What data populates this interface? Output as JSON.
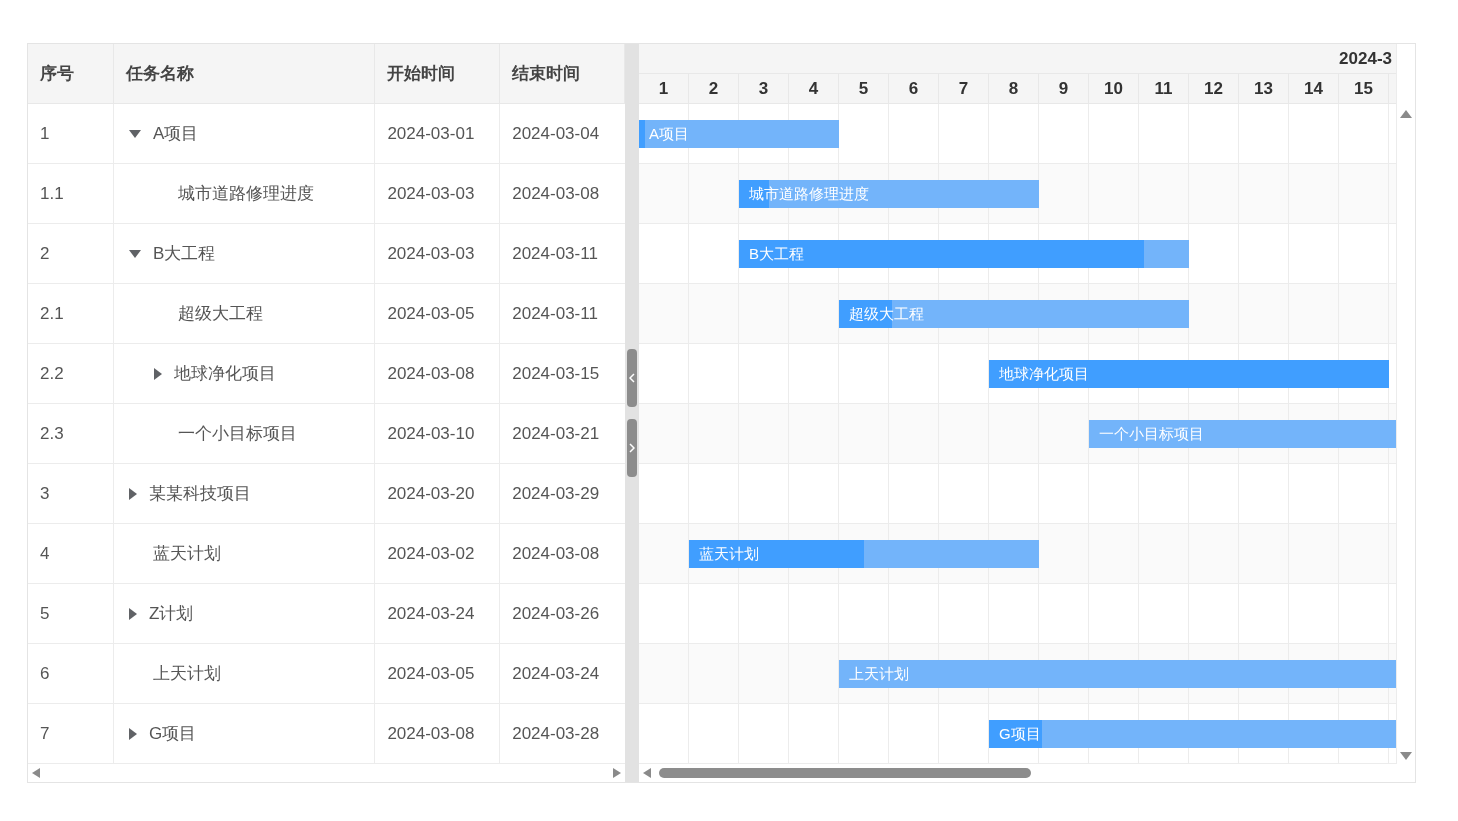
{
  "table": {
    "columns": [
      "序号",
      "任务名称",
      "开始时间",
      "结束时间"
    ],
    "rows": [
      {
        "index": "1",
        "name": "A项目",
        "start": "2024-03-01",
        "end": "2024-03-04",
        "kind": "group",
        "expanded": true,
        "children": [
          {
            "index": "1.1",
            "name": "城市道路修理进度",
            "start": "2024-03-03",
            "end": "2024-03-08",
            "kind": "leaf"
          }
        ]
      },
      {
        "index": "2",
        "name": "B大工程",
        "start": "2024-03-03",
        "end": "2024-03-11",
        "kind": "group",
        "expanded": true,
        "children": [
          {
            "index": "2.1",
            "name": "超级大工程",
            "start": "2024-03-05",
            "end": "2024-03-11",
            "kind": "leaf"
          },
          {
            "index": "2.2",
            "name": "地球净化项目",
            "start": "2024-03-08",
            "end": "2024-03-15",
            "kind": "group",
            "expanded": false
          },
          {
            "index": "2.3",
            "name": "一个小目标项目",
            "start": "2024-03-10",
            "end": "2024-03-21",
            "kind": "leaf"
          }
        ]
      },
      {
        "index": "3",
        "name": "某某科技项目",
        "start": "2024-03-20",
        "end": "2024-03-29",
        "kind": "group",
        "expanded": false
      },
      {
        "index": "4",
        "name": "蓝天计划",
        "start": "2024-03-02",
        "end": "2024-03-08",
        "kind": "leaf"
      },
      {
        "index": "5",
        "name": "Z计划",
        "start": "2024-03-24",
        "end": "2024-03-26",
        "kind": "group",
        "expanded": false
      },
      {
        "index": "6",
        "name": "上天计划",
        "start": "2024-03-05",
        "end": "2024-03-24",
        "kind": "leaf"
      },
      {
        "index": "7",
        "name": "G项目",
        "start": "2024-03-08",
        "end": "2024-03-28",
        "kind": "group",
        "expanded": false
      }
    ]
  },
  "timeline": {
    "month": "2024-3",
    "days": [
      "1",
      "2",
      "3",
      "4",
      "5",
      "6",
      "7",
      "8",
      "9",
      "10",
      "11",
      "12",
      "13",
      "14",
      "15"
    ],
    "lanes": [
      {
        "kind": "bar",
        "label": "A项目",
        "level": 0.03
      },
      {
        "kind": "bar",
        "label": "城市道路修理进度",
        "level": 0.1
      },
      {
        "kind": "bar",
        "label": "B大工程",
        "level": 0.9
      },
      {
        "kind": "bar",
        "label": "超级大工程",
        "level": 0.15
      },
      {
        "kind": "bar",
        "label": "地球净化项目",
        "level": 1
      },
      {
        "kind": "bar",
        "label": "一个小目标项目",
        "level": 0
      },
      {
        "kind": "empty"
      },
      {
        "kind": "bar",
        "label": "蓝天计划",
        "level": 0.5
      },
      {
        "kind": "empty"
      },
      {
        "kind": "bar",
        "label": "上天计划",
        "level": 0
      },
      {
        "kind": "bar",
        "label": "G项目",
        "level": 0.05
      }
    ]
  }
}
